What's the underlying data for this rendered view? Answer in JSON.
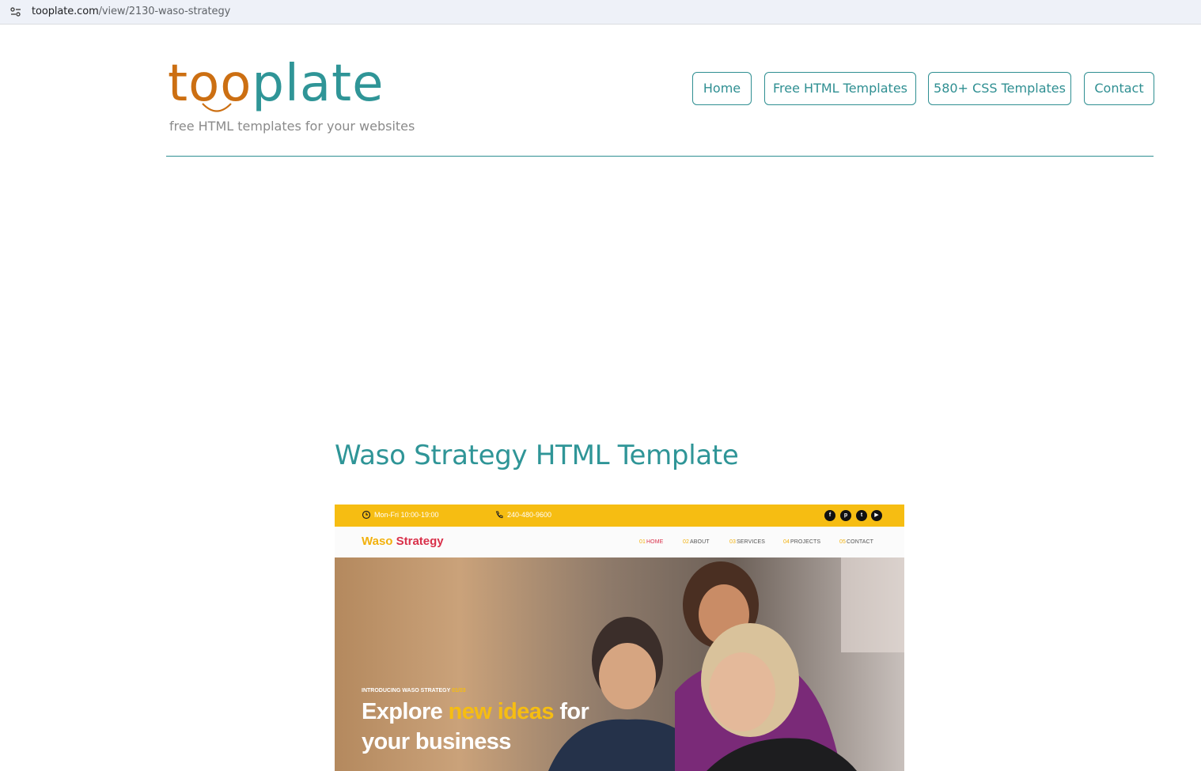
{
  "browser": {
    "url_host": "tooplate.com",
    "url_path": "/view/2130-waso-strategy",
    "site_icon": "tune-icon"
  },
  "header": {
    "logo_part1": "too",
    "logo_part2": "plate",
    "tagline": "free HTML templates for your websites",
    "colors": {
      "logo_orange": "#cc6f12",
      "brand_teal": "#2f9597"
    }
  },
  "nav": {
    "items": [
      {
        "label": "Home"
      },
      {
        "label": "Free HTML Templates"
      },
      {
        "label": "580+ CSS Templates"
      },
      {
        "label": "Contact"
      }
    ]
  },
  "main": {
    "title": "Waso Strategy HTML Template"
  },
  "preview": {
    "top_bar": {
      "hours": "Mon-Fri 10:00-19:00",
      "phone": "240-480-9600",
      "social_icons": [
        "facebook-icon",
        "pinterest-icon",
        "twitter-icon",
        "youtube-icon"
      ],
      "color": "#f6bd12"
    },
    "brand_part1": "Waso",
    "brand_part2": "Strategy",
    "nav": [
      {
        "num": "01",
        "label": "HOME"
      },
      {
        "num": "02",
        "label": "ABOUT"
      },
      {
        "num": "03",
        "label": "SERVICES"
      },
      {
        "num": "04",
        "label": "PROJECTS"
      },
      {
        "num": "05",
        "label": "CONTACT"
      }
    ],
    "hero": {
      "intro": "INTRODUCING WASO STRATEGY",
      "intro_num": "01/03",
      "head_1": "Explore",
      "head_highlight": "new ideas",
      "head_2": "for",
      "head_3": "your business"
    }
  }
}
